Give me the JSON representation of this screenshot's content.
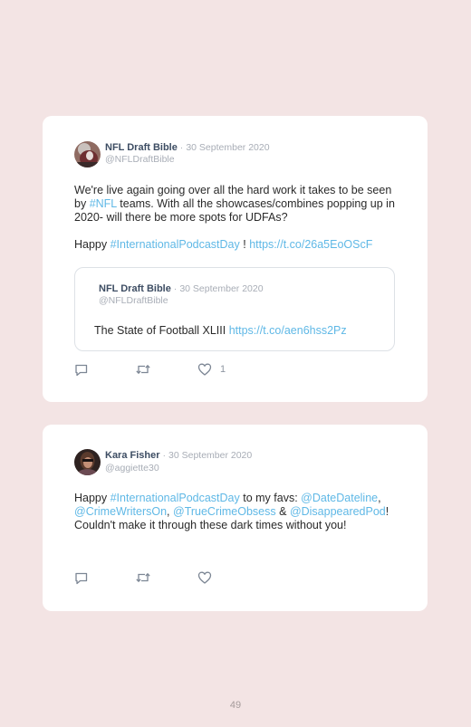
{
  "page_number": "49",
  "tweets": [
    {
      "author": "NFL Draft Bible",
      "separator": "·",
      "date": "30 September 2020",
      "handle": "@NFLDraftBible",
      "avatar_icon": "football-player-avatar",
      "body": [
        {
          "t": "We're live again going over all the hard work it takes to be seen by ",
          "link": false
        },
        {
          "t": "#NFL",
          "link": true
        },
        {
          "t": " teams. With all the showcases/combines popping up in 2020- will there be more spots for UDFAs?",
          "link": false
        }
      ],
      "body2": [
        {
          "t": "Happy ",
          "link": false
        },
        {
          "t": "#InternationalPodcastDay",
          "link": true
        },
        {
          "t": " ! ",
          "link": false
        },
        {
          "t": "https://t.co/26a5EoOScF",
          "link": true
        }
      ],
      "quoted": {
        "author": "NFL Draft Bible",
        "separator": "·",
        "date": "30 September 2020",
        "handle": "@NFLDraftBible",
        "body": [
          {
            "t": "The State of Football XLIII ",
            "link": false
          },
          {
            "t": "https://t.co/aen6hss2Pz",
            "link": true
          }
        ]
      },
      "likes": "1"
    },
    {
      "author": "Kara Fisher",
      "separator": "·",
      "date": "30 September 2020",
      "handle": "@aggiette30",
      "avatar_icon": "person-avatar",
      "body": [
        {
          "t": "Happy ",
          "link": false
        },
        {
          "t": "#InternationalPodcastDay",
          "link": true
        },
        {
          "t": " to my favs: ",
          "link": false
        },
        {
          "t": "@DateDateline",
          "link": true
        },
        {
          "t": ", ",
          "link": false
        },
        {
          "t": "@CrimeWritersOn",
          "link": true
        },
        {
          "t": ", ",
          "link": false
        },
        {
          "t": "@TrueCrimeObsess",
          "link": true
        },
        {
          "t": " & ",
          "link": false
        },
        {
          "t": "@DisappearedPod",
          "link": true
        },
        {
          "t": "! Couldn't make it through these dark times without you!",
          "link": false
        }
      ],
      "likes": ""
    }
  ],
  "colors": {
    "background": "#f3e4e4",
    "card": "#ffffff",
    "link": "#5fb8e6",
    "author": "#3d4d63",
    "muted": "#a8adb6",
    "icon": "#7c8694"
  }
}
